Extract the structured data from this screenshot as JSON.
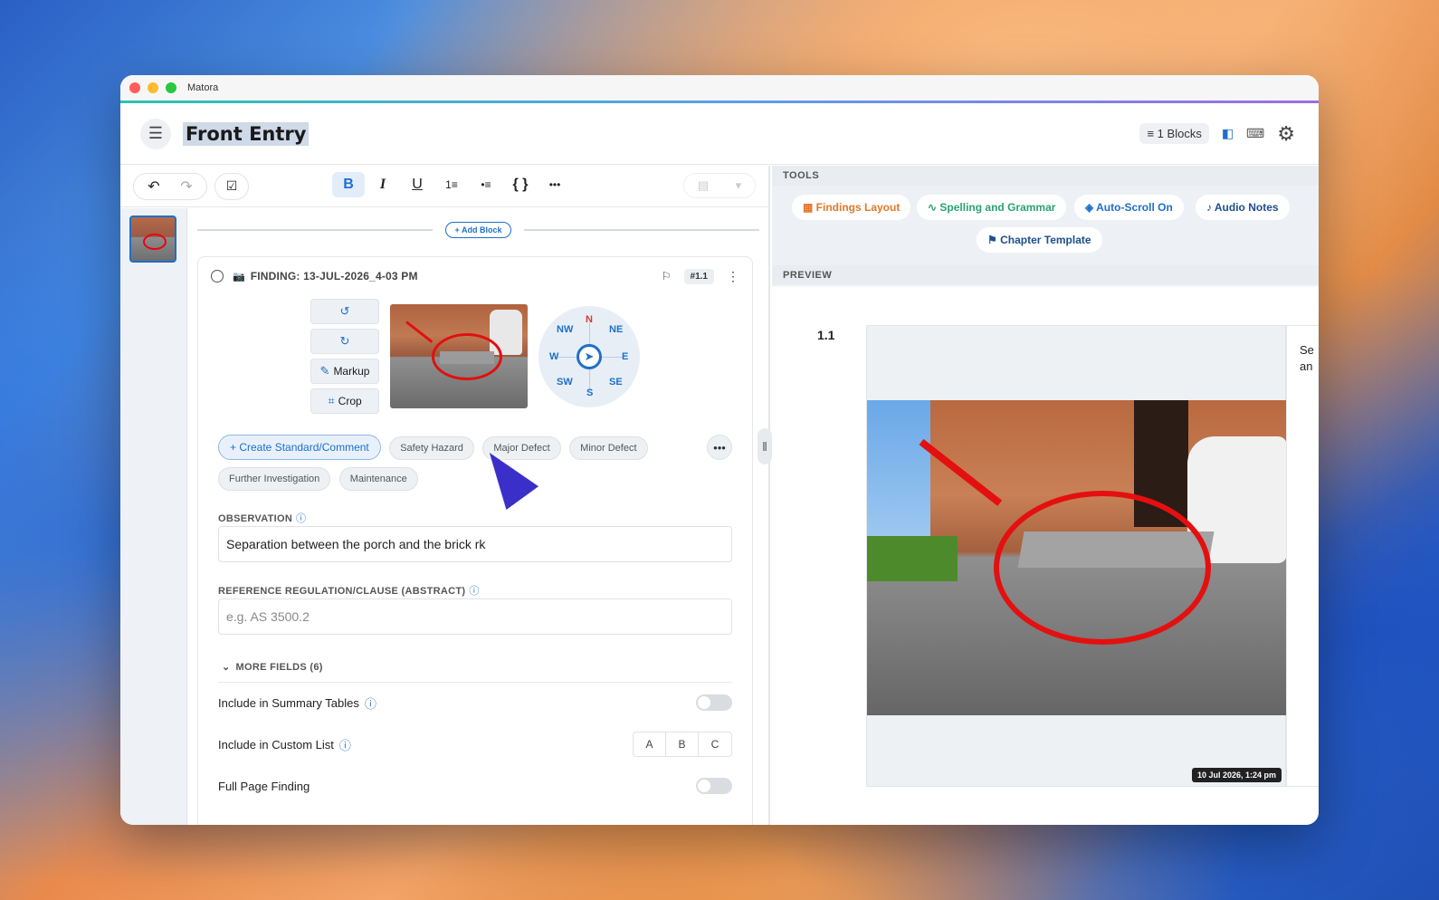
{
  "app": {
    "title": "Matora"
  },
  "header": {
    "doc_title": "Front Entry",
    "blocks_badge": "≡ 1 Blocks"
  },
  "toolbar": {
    "undo": "↶",
    "redo": "↷",
    "checklist": "☑",
    "bold": "B",
    "italic": "I",
    "underline": "U",
    "ordered_list": "1≡",
    "bullet_list": "•≡",
    "braces": "{ }",
    "more": "•••"
  },
  "editor": {
    "add_block_label": "+ Add Block",
    "finding": {
      "title": "FINDING: 13-JUL-2026_4-03 PM",
      "id_badge": "#1.1",
      "image_tools": {
        "rotate_left": "↺",
        "rotate_right": "↻",
        "markup": "Markup",
        "crop": "Crop"
      },
      "compass": {
        "n": "N",
        "ne": "NE",
        "e": "E",
        "se": "SE",
        "s": "S",
        "sw": "SW",
        "w": "W",
        "nw": "NW"
      },
      "chips": {
        "create": "+ Create Standard/Comment",
        "safety": "Safety Hazard",
        "major": "Major Defect",
        "minor": "Minor Defect",
        "further": "Further Investigation",
        "maintenance": "Maintenance"
      },
      "observation_label": "OBSERVATION",
      "observation_value": "Separation between the porch and the brick  rk",
      "reference_label": "REFERENCE REGULATION/CLAUSE (ABSTRACT)",
      "reference_placeholder": "e.g. AS 3500.2",
      "more_fields": "MORE FIELDS (6)",
      "include_summary": "Include in Summary Tables",
      "include_custom": "Include in Custom List",
      "custom_options": [
        "A",
        "B",
        "C"
      ],
      "full_page": "Full Page Finding"
    }
  },
  "right": {
    "tools_label": "TOOLS",
    "tools": {
      "findings_layout": "Findings Layout",
      "spelling": "Spelling and Grammar",
      "autoscroll": "Auto-Scroll On",
      "audio": "Audio Notes",
      "chapter": "Chapter Template"
    },
    "preview_label": "PREVIEW",
    "section_number": "1.1",
    "timestamp": "10 Jul 2026, 1:24 pm",
    "side_text": "Se an"
  },
  "colors": {
    "accent": "#1f6fc9",
    "findings_layout": "#e0782a",
    "spelling": "#2aa373",
    "markup_red": "#e01010"
  }
}
